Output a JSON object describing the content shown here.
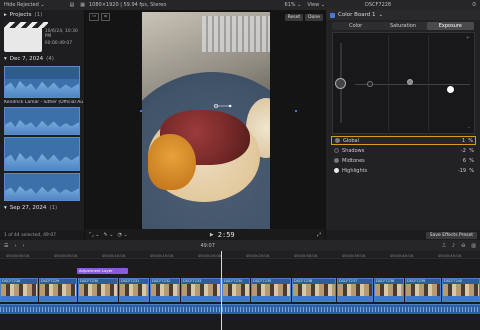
{
  "topbar": {
    "filter_label": "Hide Rejected",
    "filter_chevron": "⌄",
    "viewer_info": "1080×1920 | 59.94 fps, Stereo",
    "zoom_label": "61%",
    "view_label": "View",
    "clip_name": "DSCF7228"
  },
  "browser": {
    "projects_label": "Projects",
    "projects_count": "(1)",
    "project_date": "10/6/24, 10:30 PM",
    "project_duration": "00:00:49:07",
    "event1_label": "Dec 7, 2024",
    "event1_count": "(4)",
    "clip_label": "Kendrick Lamar - luther (Official Au",
    "event2_label": "Sep 27, 2024",
    "event2_count": "(1)",
    "footer": "1 of 44 selected, 49:07"
  },
  "viewer": {
    "reset_label": "Reset",
    "done_label": "Done",
    "timecode": "2:59"
  },
  "inspector": {
    "title": "Color Board 1",
    "tabs": [
      "Color",
      "Saturation",
      "Exposure"
    ],
    "active_tab": "Exposure",
    "params": [
      {
        "name": "Global",
        "value": "1",
        "pct": "%",
        "color": "#7a7a7a"
      },
      {
        "name": "Shadows",
        "value": "-2",
        "pct": "%",
        "color": "#2a2a2a"
      },
      {
        "name": "Midtones",
        "value": "6",
        "pct": "%",
        "color": "#777777"
      },
      {
        "name": "Highlights",
        "value": "-19",
        "pct": "%",
        "color": "#e8e8e8"
      }
    ],
    "save_label": "Save Effects Preset"
  },
  "timeline": {
    "timecode": "49:07",
    "ruler_marks": [
      "00:00:00:00",
      "00:00:05:00",
      "00:00:10:00",
      "00:00:15:00",
      "00:00:20:00",
      "00:00:25:00",
      "00:00:30:00",
      "00:00:35:00",
      "00:00:40:00",
      "00:00:45:00"
    ],
    "adjustment_label": "Adjustment Layer",
    "clips": [
      "DSCF7228",
      "DSCF7229",
      "DSCF7230",
      "DSCF7231",
      "DSCF7232",
      "DSCF7233",
      "DSCF7234",
      "DSCF7235",
      "DSCF7236",
      "DSCF7237",
      "DSCF7238",
      "DSCF7239",
      "DSCF7240"
    ]
  },
  "colors": {
    "accent": "#d4a017",
    "selection": "#4a78d6",
    "purple": "#8a5bd6"
  }
}
